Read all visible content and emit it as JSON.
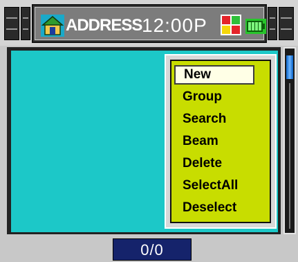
{
  "header": {
    "app_title": "ADDRESS",
    "clock": "12:00P",
    "icons": [
      "home-icon",
      "launcher-icon",
      "battery-icon"
    ]
  },
  "menu": {
    "items": [
      "New",
      "Group",
      "Search",
      "Beam",
      "Delete",
      "SelectAll",
      "Deselect"
    ],
    "selected": "New"
  },
  "footer": {
    "counter": "0/0"
  },
  "colors": {
    "list_background": "#1cc8c8",
    "menu_background": "#c8dd00",
    "counter_background": "#15236b"
  }
}
